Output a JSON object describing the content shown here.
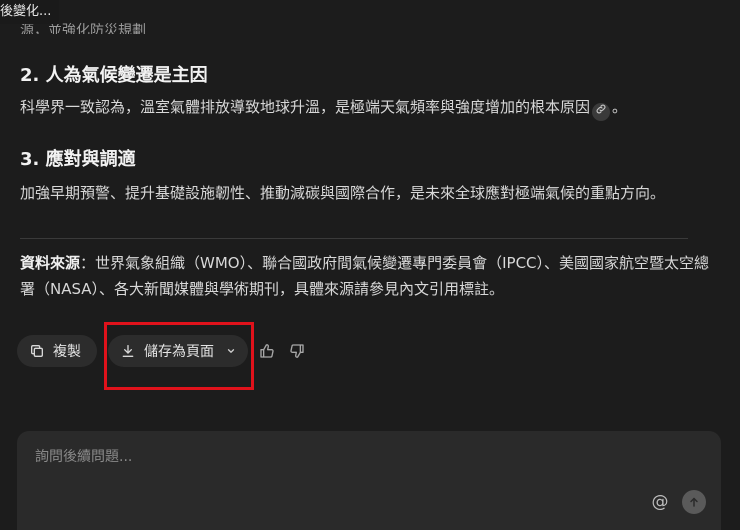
{
  "tooltip": {
    "text": "後變化..."
  },
  "article": {
    "cut_text": "源，並強化防災規劃",
    "sections": [
      {
        "heading": "2. 人為氣候變遷是主因",
        "body": "科學界一致認為，溫室氣體排放導致地球升溫，是極端天氣頻率與強度增加的根本原因",
        "body_end": "。"
      },
      {
        "heading": "3. 應對與調適",
        "body": "加強早期預警、提升基礎設施韌性、推動減碳與國際合作，是未來全球應對極端氣候的重點方向。"
      }
    ],
    "sources_label": "資料來源",
    "sources_text": "：世界氣象組織（WMO）、聯合國政府間氣候變遷專門委員會（IPCC）、美國國家航空暨太空總署（NASA）、各大新聞媒體與學術期刊，具體來源請參見內文引用標註。"
  },
  "actions": {
    "copy_label": "複製",
    "save_label": "儲存為頁面"
  },
  "composer": {
    "placeholder": "詢問後續問題...",
    "mention_symbol": "@"
  },
  "colors": {
    "background": "#1c1c1c",
    "highlight": "#e0121b",
    "button_bg": "#2c2c2c",
    "composer_bg": "#2a2a2a"
  },
  "icons": [
    "copy-icon",
    "download-icon",
    "chevron-down-icon",
    "thumbs-up-icon",
    "thumbs-down-icon",
    "link-icon",
    "send-arrow-icon"
  ]
}
